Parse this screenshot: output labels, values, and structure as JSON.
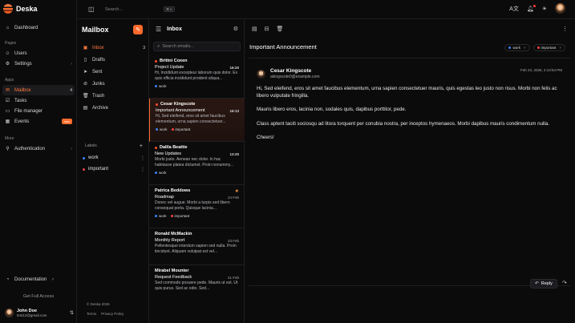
{
  "app": {
    "name": "Deska"
  },
  "topbar": {
    "search_placeholder": "Search...",
    "shortcut": "⌘ K"
  },
  "sidebar": {
    "main": [
      {
        "label": "Dashboard",
        "icon": "home-icon"
      }
    ],
    "pages_title": "Pages",
    "pages": [
      {
        "label": "Users",
        "icon": "users-icon"
      },
      {
        "label": "Settings",
        "icon": "gear-icon"
      }
    ],
    "apps_title": "Apps",
    "apps": [
      {
        "label": "Mailbox",
        "icon": "mail-icon",
        "count": "4",
        "active": true
      },
      {
        "label": "Tasks",
        "icon": "check-icon"
      },
      {
        "label": "File manager",
        "icon": "folder-icon"
      },
      {
        "label": "Events",
        "icon": "calendar-icon",
        "badge": "new"
      }
    ],
    "more_title": "More",
    "more": [
      {
        "label": "Authentication",
        "icon": "user-icon"
      }
    ],
    "documentation": "Documentation",
    "get_full_access": "Get Full Access",
    "user": {
      "name": "John Doe",
      "email": "test12@gmail.com"
    }
  },
  "mailbox": {
    "title": "Mailbox",
    "folders": [
      {
        "label": "Inbox",
        "count": "3",
        "active": true
      },
      {
        "label": "Drafts"
      },
      {
        "label": "Sent"
      },
      {
        "label": "Junks"
      },
      {
        "label": "Trash"
      },
      {
        "label": "Archive"
      }
    ],
    "labels_title": "Labels",
    "labels": [
      {
        "name": "work",
        "color": "#3b82f6"
      },
      {
        "name": "important",
        "color": "#ef4444"
      }
    ],
    "footer": "© Deska 2026",
    "terms": "Terms",
    "privacy": "Privacy Policy"
  },
  "inbox": {
    "title": "Inbox",
    "search_placeholder": "Search emails...",
    "emails": [
      {
        "from": "Brittni Coxen",
        "subject": "Project Update",
        "date": "16:20",
        "unread": true,
        "preview": "Hi, Incididunt excepteur laborum quis dolor. Ex quis officia incididunt proident aliqua..."
      },
      {
        "from": "Cesar Kingscote",
        "subject": "Important Announcement",
        "date": "16:13",
        "unread": true,
        "preview": "Hi, Sed eleifend, eros sit amet faucibus elementum, urna sapien consectetuer..."
      },
      {
        "from": "Dalila Beattie",
        "subject": "New Updates",
        "date": "13:20",
        "unread": true,
        "preview": "Morbi justo. Aenean nec dolor. In hac habitasse platea dictumst. Proin nonummy..."
      },
      {
        "from": "Patrica Beddows",
        "subject": "Roadmap",
        "date": "24 Feb",
        "starred": true,
        "preview": "Donec vel augue. Morbi a turpis sed libero consequat porta. Quisque lacinia..."
      },
      {
        "from": "Ronald McMackin",
        "subject": "Monthly Report",
        "date": "23 Feb",
        "preview": "Pellentesque interdum sapien sed nulla. Proin tincidunt. Aliquam volutpat est vel..."
      },
      {
        "from": "Mirabel Mounter",
        "subject": "Request Feedback",
        "date": "21 Feb",
        "preview": "Sed commodo posuere pede. Mauris ut est. Ut quis purus. Sed ac odio. Sed..."
      }
    ]
  },
  "detail": {
    "subject": "Important Announcement",
    "tags": [
      {
        "name": "work",
        "color": "#3b82f6"
      },
      {
        "name": "important",
        "color": "#ef4444"
      }
    ],
    "sender": {
      "name": "Cesar Kingscote",
      "email": "akingscote0@example.com"
    },
    "date": "Feb 23, 2026, 4:13:54 PM",
    "body": [
      "Hi, Sed eleifend, eros sit amet faucibus elementum, urna sapien consectetuer mauris, quis egestas leo justo non risus. Morbi non felis ac libero vulputate fringilla.",
      "Mauris libero eros, lacinia non, sodales quis, dapibus porttitor, pede.",
      "Class aptent taciti sociosqu ad litora torquent per conubia nostra, per inceptos hymenaeos. Morbi dapibus mauris condimentum nulla.",
      "Cheers!"
    ],
    "reply_label": "Reply"
  }
}
